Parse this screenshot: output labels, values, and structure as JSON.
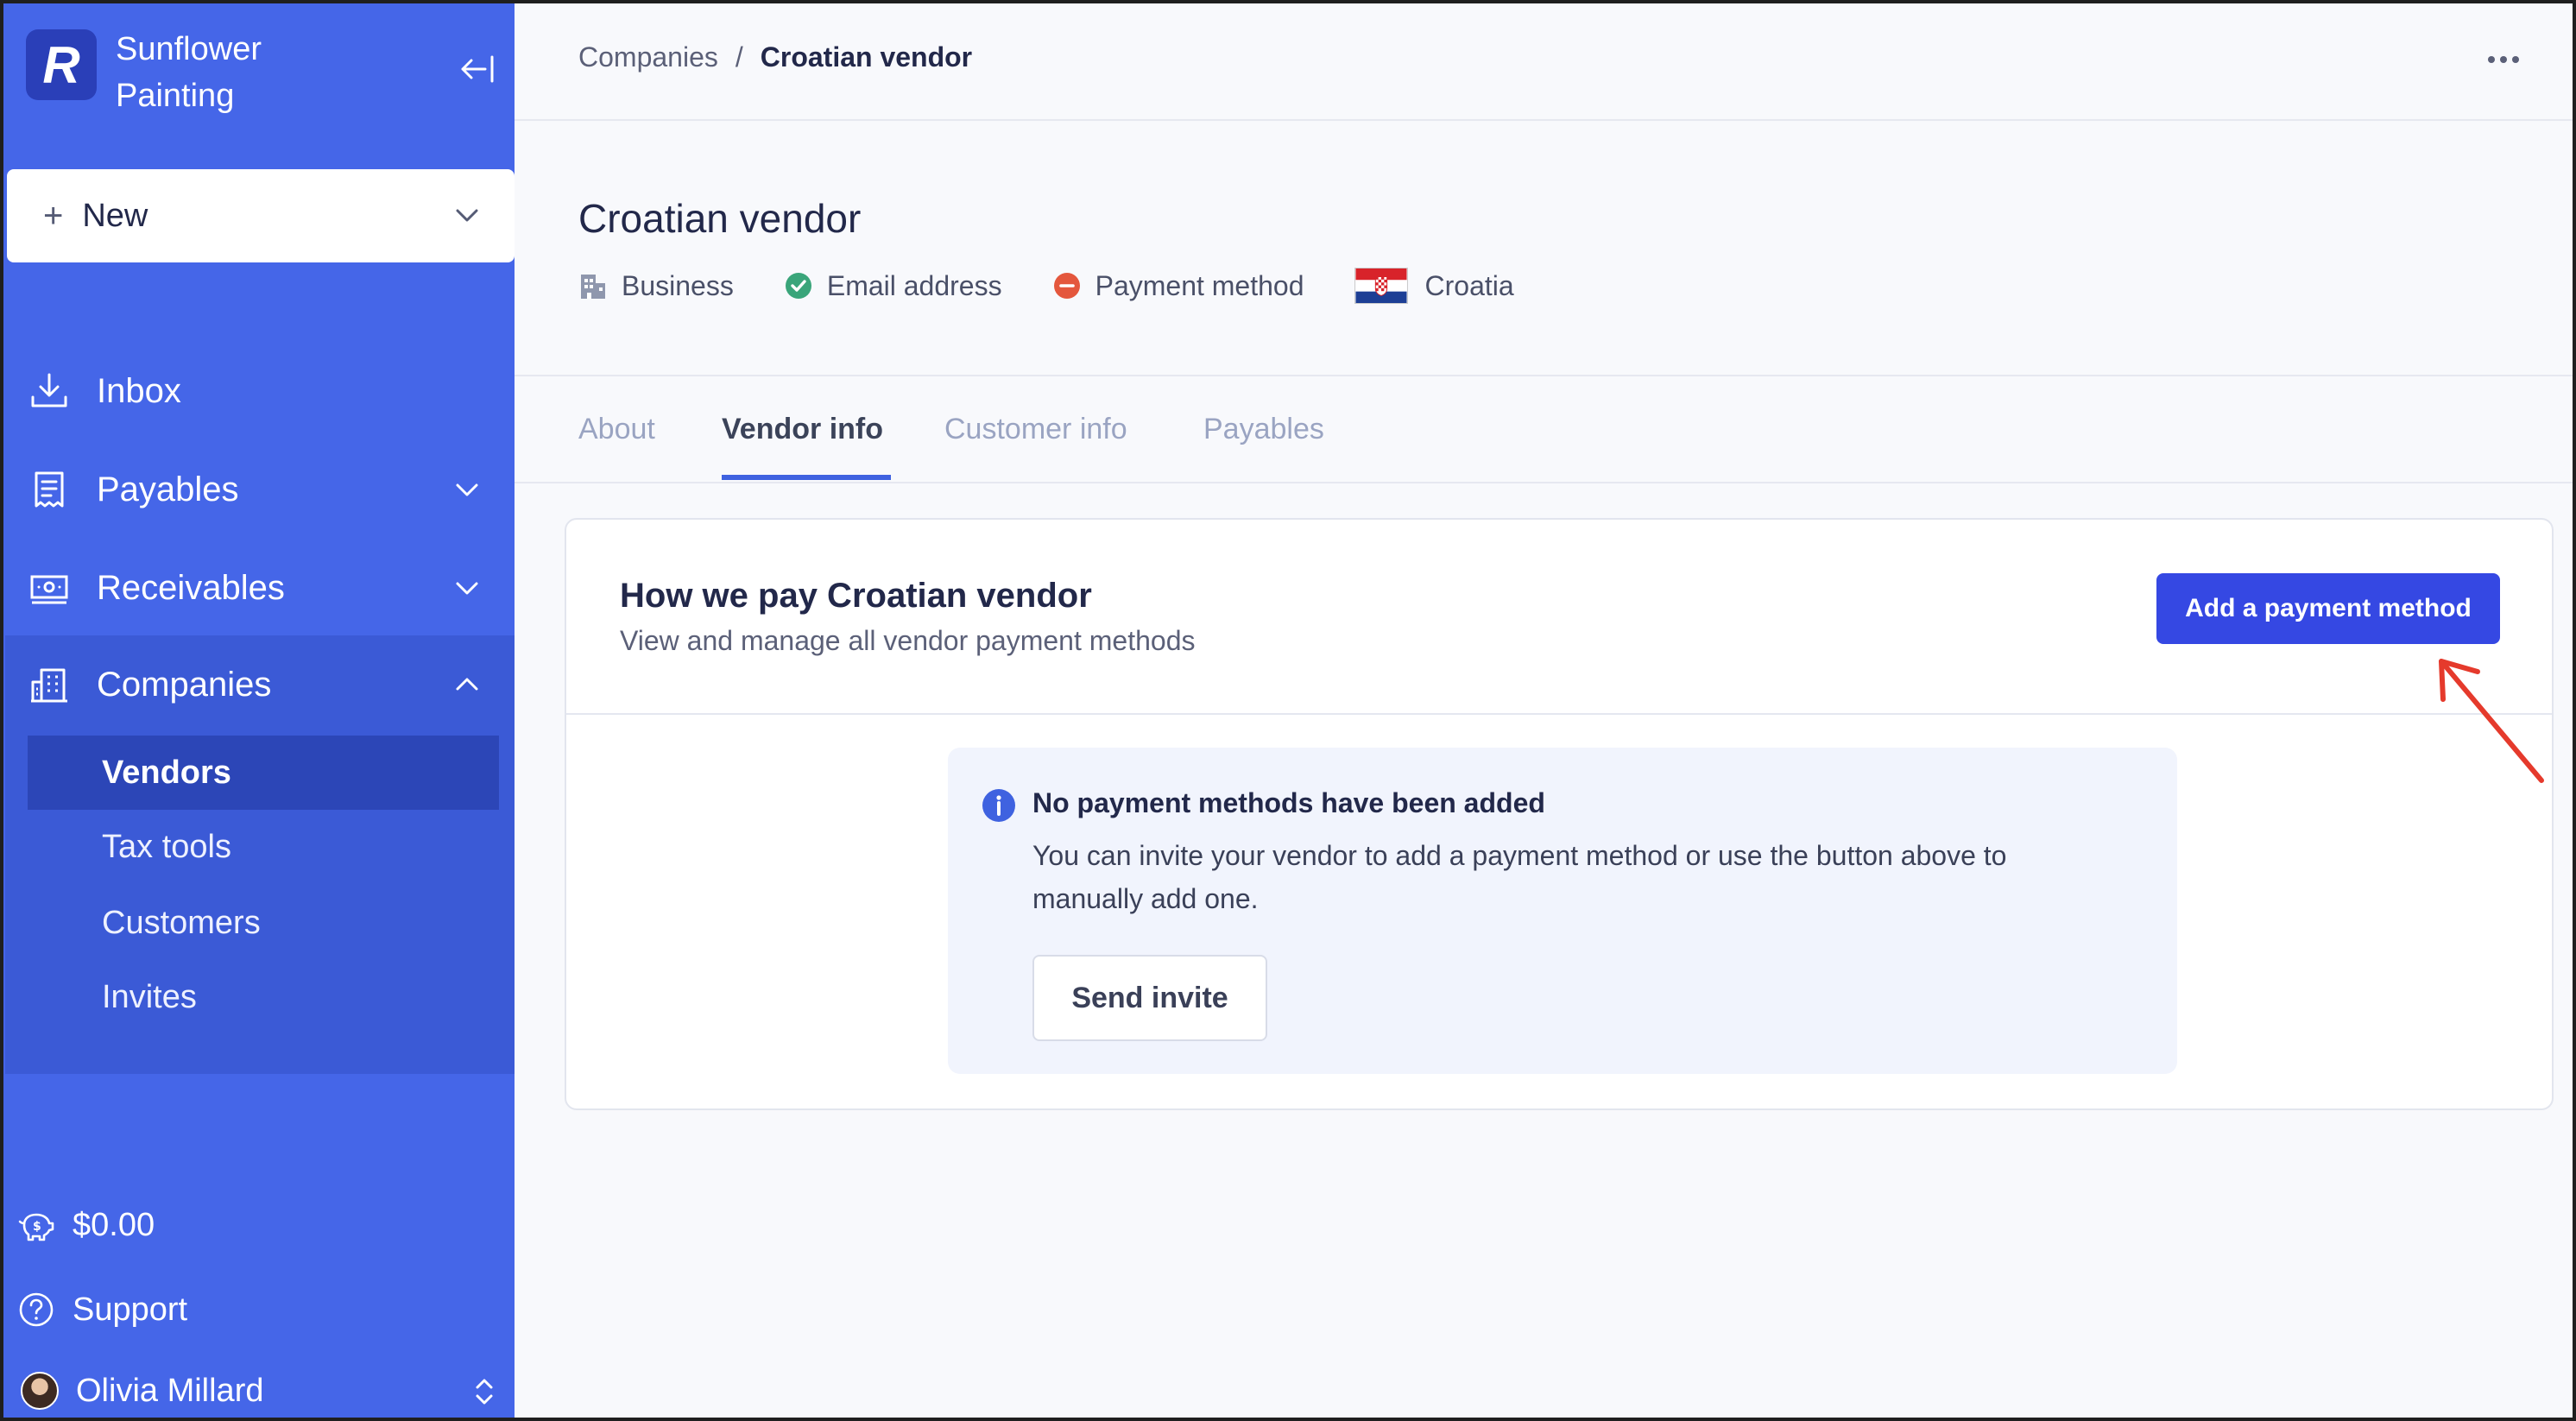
{
  "sidebar": {
    "brand_name": "Sunflower Painting",
    "logo_letter": "R",
    "new_button": {
      "plus": "+",
      "label": "New"
    },
    "nav": {
      "inbox": "Inbox",
      "payables": "Payables",
      "receivables": "Receivables",
      "companies": "Companies"
    },
    "companies_sub": {
      "vendors": "Vendors",
      "tax_tools": "Tax tools",
      "customers": "Customers",
      "invites": "Invites"
    },
    "balance": "$0.00",
    "support": "Support",
    "user_name": "Olivia Millard"
  },
  "breadcrumb": {
    "parent": "Companies",
    "separator": "/",
    "current": "Croatian vendor"
  },
  "header": {
    "title": "Croatian vendor",
    "badges": {
      "type": "Business",
      "email": "Email address",
      "payment": "Payment method",
      "country": "Croatia"
    }
  },
  "tabs": {
    "about": "About",
    "vendor_info": "Vendor info",
    "customer_info": "Customer info",
    "payables": "Payables"
  },
  "card": {
    "title": "How we pay Croatian vendor",
    "subtitle": "View and manage all vendor payment methods",
    "add_button": "Add a payment method"
  },
  "empty_state": {
    "title": "No payment methods have been added",
    "description": "You can invite your vendor to add a payment method or use the button above to manually add one.",
    "invite_button": "Send invite"
  },
  "colors": {
    "sidebar": "#4566e8",
    "accent": "#3548e3",
    "success": "#3aa57a",
    "danger": "#e4573d",
    "annotation": "#e53a2c"
  }
}
